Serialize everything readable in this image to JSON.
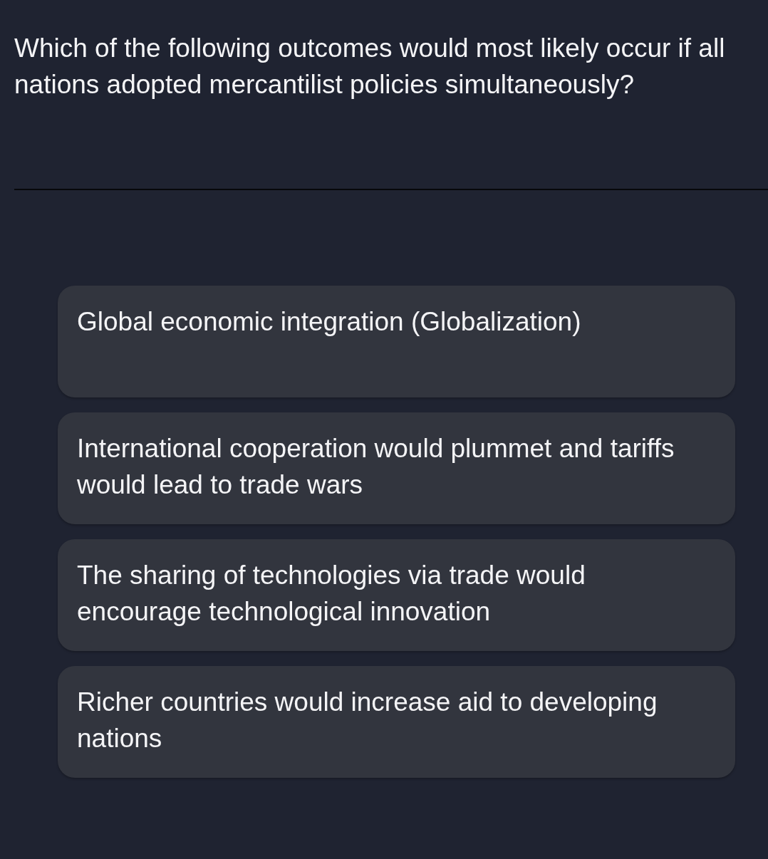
{
  "question": "Which of the following outcomes would most likely occur if all nations adopted mercantilist policies simultaneously?",
  "options": [
    {
      "text": "Global economic integration (Globalization)",
      "selected": false
    },
    {
      "text": "International cooperation would plummet and tariffs would lead to trade wars",
      "selected": false
    },
    {
      "text": "The sharing of technologies via trade would encourage technological innovation",
      "selected": false
    },
    {
      "text": "Richer countries would increase aid to developing nations",
      "selected": false
    }
  ]
}
